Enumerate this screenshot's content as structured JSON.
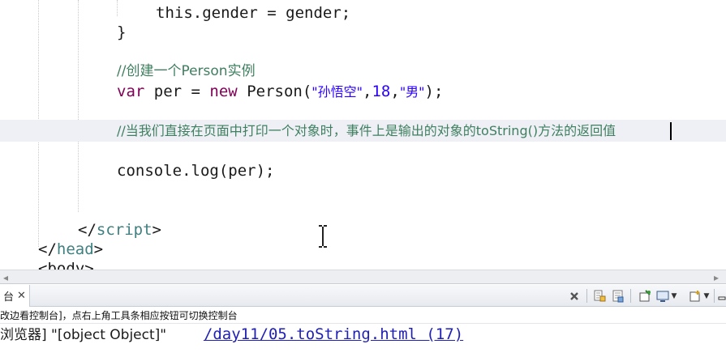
{
  "editor": {
    "lines": [
      "this.gender = gender;",
      "}",
      "//创建一个Person实例",
      "var",
      "per = ",
      "new",
      "Person(",
      "\"孙悟空\"",
      ",",
      "18",
      ",",
      "\"男\"",
      ");",
      "//当我们直接在页面中打印一个对象时，事件上是输出的对象的toString()方法的返回值",
      "console.log(per);",
      "</",
      "script",
      ">",
      "</",
      "head",
      ">",
      "<body>"
    ]
  },
  "console": {
    "tab_label": "台",
    "tab_close": "✕",
    "toolbar_icons": [
      "clear-console-icon",
      "scroll-lock-icon",
      "word-wrap-icon",
      "pin-console-icon",
      "display-console-icon",
      "open-console-icon",
      "minimize-icon"
    ],
    "info_text": "改边看控制台]，点右上角工具条相应按钮可切换控制台",
    "log_prefix": "浏览器] \"[object Object]\"",
    "log_link": "/day11/05.toString.html (17)"
  },
  "colors": {
    "keyword": "#7f0055",
    "comment": "#3f7f5f",
    "string": "#2a00ff",
    "tag": "#3f7f7f",
    "link": "#1f1fb5"
  }
}
